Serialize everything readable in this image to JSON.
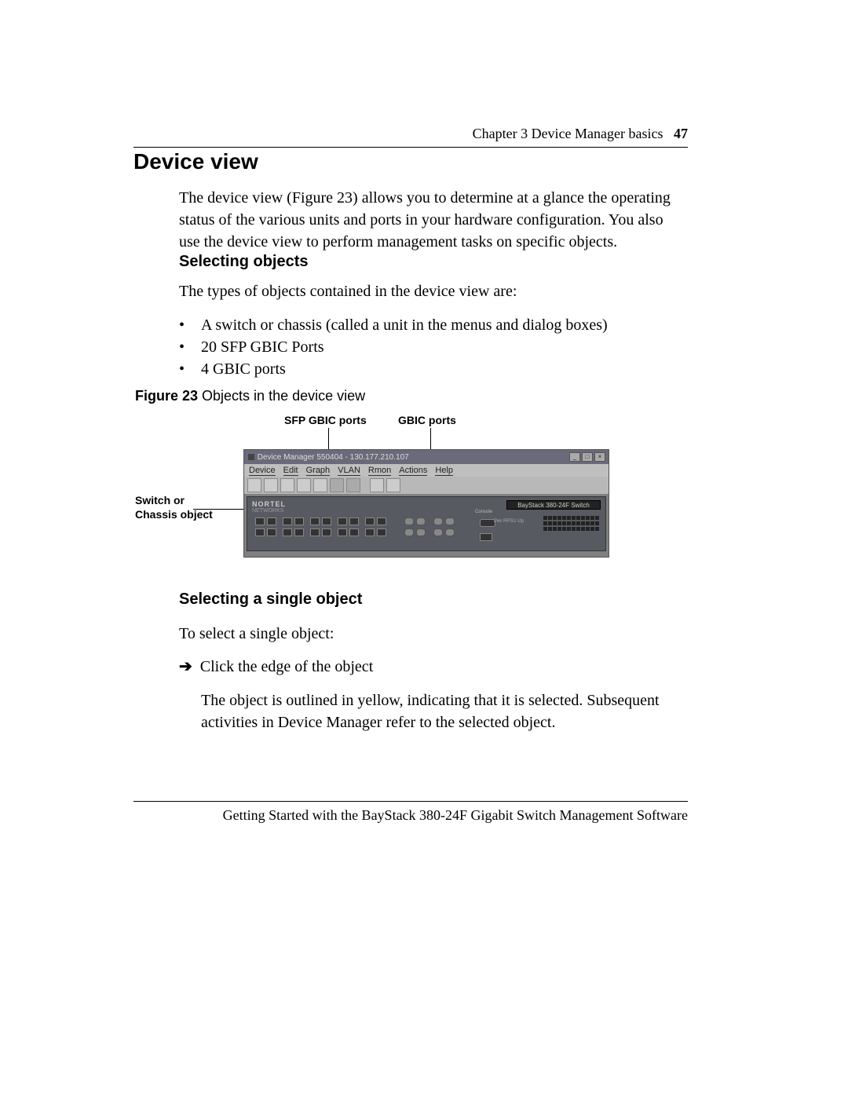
{
  "header": {
    "chapter": "Chapter 3  Device Manager basics",
    "page_num": "47"
  },
  "title": "Device view",
  "para1": "The device view (Figure 23) allows you to determine at a glance the operating status of the various units and ports in your hardware configuration. You also use the device view to perform management tasks on specific objects.",
  "subhead1": "Selecting objects",
  "para2": "The types of objects contained in the device view are:",
  "bullets": [
    "A switch or chassis (called a unit in the menus and dialog boxes)",
    "20 SFP GBIC Ports",
    "4 GBIC ports"
  ],
  "figure": {
    "caption_bold": "Figure 23",
    "caption_rest": "   Objects in the device view",
    "label_sfp": "SFP GBIC ports",
    "label_gbic": "GBIC ports",
    "label_chassis": "Switch or Chassis object"
  },
  "dm": {
    "title": "Device Manager 550404 - 130.177.210.107",
    "menus": [
      "Device",
      "Edit",
      "Graph",
      "VLAN",
      "Rmon",
      "Actions",
      "Help"
    ],
    "brand": "NORTEL",
    "brand_sub": "NETWORKS",
    "model": "BayStack 380-24F Switch",
    "console": "Console",
    "led_labels": "Pwr\nRPSU\nUp"
  },
  "subhead2": "Selecting a single object",
  "para3": "To select a single object:",
  "arrow_text": "Click the edge of the object",
  "para4": "The object is outlined in yellow, indicating that it is selected. Subsequent activities in Device Manager refer to the selected object.",
  "footer": "Getting Started with the BayStack 380-24F Gigabit Switch Management Software"
}
